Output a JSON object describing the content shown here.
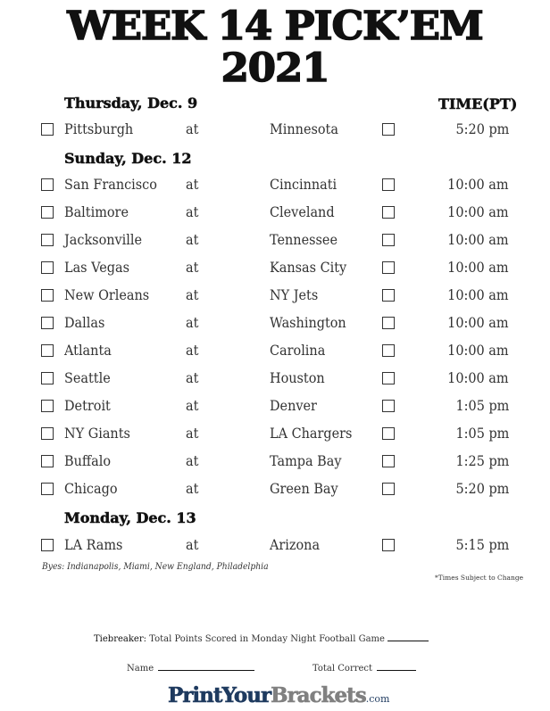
{
  "title": {
    "line1": "WEEK 14 PICK’EM",
    "line2": "2021"
  },
  "time_header": "TIME(PT)",
  "days": [
    {
      "label": "Thursday, Dec. 9",
      "games": [
        {
          "away": "Pittsburgh",
          "at": "at",
          "home": "Minnesota",
          "time": "5:20 pm"
        }
      ]
    },
    {
      "label": "Sunday, Dec. 12",
      "games": [
        {
          "away": "San Francisco",
          "at": "at",
          "home": "Cincinnati",
          "time": "10:00 am"
        },
        {
          "away": "Baltimore",
          "at": "at",
          "home": "Cleveland",
          "time": "10:00 am"
        },
        {
          "away": "Jacksonville",
          "at": "at",
          "home": "Tennessee",
          "time": "10:00 am"
        },
        {
          "away": "Las Vegas",
          "at": "at",
          "home": "Kansas City",
          "time": "10:00 am"
        },
        {
          "away": "New Orleans",
          "at": "at",
          "home": "NY Jets",
          "time": "10:00 am"
        },
        {
          "away": "Dallas",
          "at": "at",
          "home": "Washington",
          "time": "10:00 am"
        },
        {
          "away": "Atlanta",
          "at": "at",
          "home": "Carolina",
          "time": "10:00 am"
        },
        {
          "away": "Seattle",
          "at": "at",
          "home": "Houston",
          "time": "10:00 am"
        },
        {
          "away": "Detroit",
          "at": "at",
          "home": "Denver",
          "time": "1:05 pm"
        },
        {
          "away": "NY Giants",
          "at": "at",
          "home": "LA Chargers",
          "time": "1:05 pm"
        },
        {
          "away": "Buffalo",
          "at": "at",
          "home": "Tampa Bay",
          "time": "1:25 pm"
        },
        {
          "away": "Chicago",
          "at": "at",
          "home": "Green Bay",
          "time": "5:20 pm"
        }
      ]
    },
    {
      "label": "Monday, Dec. 13",
      "games": [
        {
          "away": "LA Rams",
          "at": "at",
          "home": "Arizona",
          "time": "5:15 pm"
        }
      ]
    }
  ],
  "byes": "Byes: Indianapolis, Miami, New England, Philadelphia",
  "note": "*Times Subject to Change",
  "footer": {
    "tiebreaker_label": "Tiebreaker:",
    "tiebreaker_text": "Total Points Scored in Monday Night Football Game",
    "name_label": "Name",
    "total_correct_label": "Total Correct"
  },
  "logo": {
    "part1": "PrintYour",
    "part2": "Brackets",
    "part3": ".com"
  }
}
